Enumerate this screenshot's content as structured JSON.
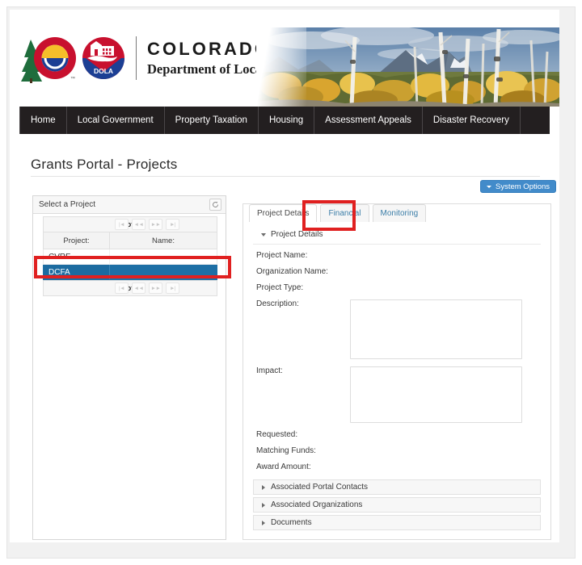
{
  "header": {
    "wordmark_top": "COLORADO",
    "wordmark_bottom": "Department of Local Affairs",
    "dola_seal_text": "DOLA",
    "banner_alt": "colorado-aspen-mountain-landscape"
  },
  "nav": {
    "items": [
      {
        "label": "Home"
      },
      {
        "label": "Local Government"
      },
      {
        "label": "Property Taxation"
      },
      {
        "label": "Housing"
      },
      {
        "label": "Assessment Appeals"
      },
      {
        "label": "Disaster Recovery"
      }
    ]
  },
  "page": {
    "title": "Grants Portal - Projects",
    "system_options_label": "System Options"
  },
  "left_panel": {
    "title": "Select a Project",
    "refresh_icon": "refresh-icon",
    "pager": {
      "count_label": "(1 of 1)",
      "buttons": [
        {
          "name": "first-page",
          "glyph": "|◄"
        },
        {
          "name": "prev-page",
          "glyph": "◄◄"
        },
        {
          "name": "next-page",
          "glyph": "►►"
        },
        {
          "name": "last-page",
          "glyph": "►|"
        }
      ]
    },
    "columns": [
      {
        "label": "Project:"
      },
      {
        "label": "Name:"
      }
    ],
    "rows": [
      {
        "project": "CVRF",
        "name": "",
        "selected": false
      },
      {
        "project": "DCFA",
        "name": "",
        "selected": true
      }
    ]
  },
  "right_panel": {
    "tabs": [
      {
        "label": "Project Details",
        "active": true
      },
      {
        "label": "Financial",
        "active": false
      },
      {
        "label": "Monitoring",
        "active": false
      }
    ],
    "section_title": "Project Details",
    "fields": [
      {
        "label": "Project Name:",
        "value": ""
      },
      {
        "label": "Organization Name:",
        "value": ""
      },
      {
        "label": "Project Type:",
        "value": ""
      }
    ],
    "description_label": "Description:",
    "description_value": "",
    "impact_label": "Impact:",
    "impact_value": "",
    "amount_fields": [
      {
        "label": "Requested:",
        "value": ""
      },
      {
        "label": "Matching Funds:",
        "value": ""
      },
      {
        "label": "Award Amount:",
        "value": ""
      }
    ],
    "accordions": [
      {
        "label": "Associated Portal Contacts"
      },
      {
        "label": "Associated Organizations"
      },
      {
        "label": "Documents"
      }
    ]
  },
  "annotations": {
    "tab_highlight": "financial-tab-highlight",
    "row_highlight": "dcfa-row-highlight"
  },
  "colors": {
    "nav_bg": "#231f20",
    "accent_blue": "#428bca",
    "selection_blue": "#1d6fa5",
    "annotation_red": "#e02020"
  }
}
